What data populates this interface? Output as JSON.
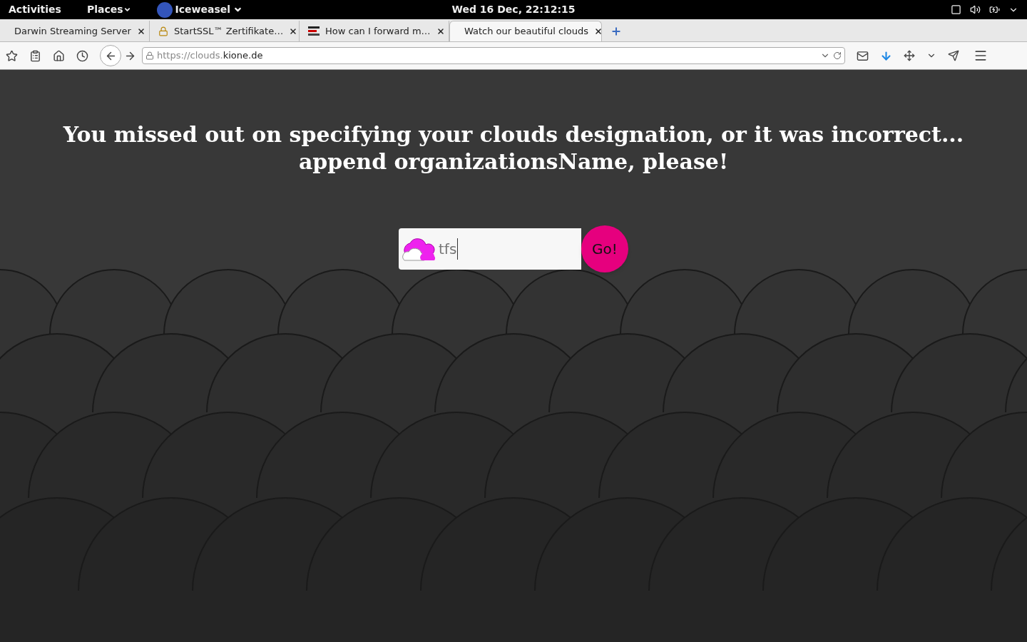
{
  "top_bar": {
    "activities": "Activities",
    "places": "Places",
    "app": "Iceweasel",
    "clock": "Wed 16 Dec, 22:12:15"
  },
  "tabs": [
    {
      "label": "Darwin Streaming Server",
      "selected": false,
      "kind": "plain"
    },
    {
      "label": "StartSSL™ Zertifikate…",
      "selected": false,
      "kind": "secure"
    },
    {
      "label": "How can I forward m…",
      "selected": false,
      "kind": "site"
    },
    {
      "label": "Watch our beautiful clouds",
      "selected": true,
      "kind": "plain"
    }
  ],
  "address_bar": {
    "url_prefix": "https://clouds.",
    "url_domain": "kione.de"
  },
  "page": {
    "heading_line_1": "You missed out on specifying your clouds designation, or it was incorrect...",
    "heading_line_2": "append organizationsName, please!",
    "input_value": "tfs",
    "go_button": "Go!"
  }
}
